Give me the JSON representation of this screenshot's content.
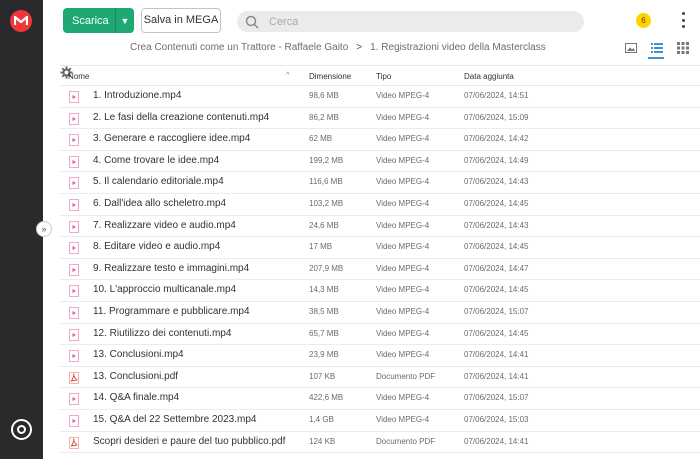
{
  "toolbar": {
    "download_label": "Scarica",
    "save_label": "Salva in MEGA",
    "search_placeholder": "Cerca",
    "notification_count": "6"
  },
  "breadcrumb": {
    "parent": "Crea Contenuti come un Trattore - Raffaele Gaito",
    "separator": ">",
    "current": "1. Registrazioni video della Masterclass"
  },
  "colors": {
    "accent_green": "#1fa873",
    "sidebar": "#2a2a2c",
    "mega_red": "#f0373a",
    "notification": "#ffd300",
    "active_view": "#3c90d4"
  },
  "table": {
    "headers": {
      "name": "Nome",
      "size": "Dimensione",
      "type": "Tipo",
      "date": "Data aggiunta"
    },
    "sort_indicator": "^",
    "rows": [
      {
        "name": "1. Introduzione.mp4",
        "size": "98,6 MB",
        "type": "Video MPEG-4",
        "date": "07/06/2024, 14:51",
        "icon": "video-file-icon"
      },
      {
        "name": "2. Le fasi della creazione contenuti.mp4",
        "size": "86,2 MB",
        "type": "Video MPEG-4",
        "date": "07/06/2024, 15:09",
        "icon": "video-file-icon"
      },
      {
        "name": "3. Generare e raccogliere idee.mp4",
        "size": "62 MB",
        "type": "Video MPEG-4",
        "date": "07/06/2024, 14:42",
        "icon": "video-file-icon"
      },
      {
        "name": "4. Come trovare le idee.mp4",
        "size": "199,2 MB",
        "type": "Video MPEG-4",
        "date": "07/06/2024, 14:49",
        "icon": "video-file-icon"
      },
      {
        "name": "5. Il calendario editoriale.mp4",
        "size": "116,6 MB",
        "type": "Video MPEG-4",
        "date": "07/06/2024, 14:43",
        "icon": "video-file-icon"
      },
      {
        "name": "6. Dall'idea allo scheletro.mp4",
        "size": "103,2 MB",
        "type": "Video MPEG-4",
        "date": "07/06/2024, 14:45",
        "icon": "video-file-icon"
      },
      {
        "name": "7. Realizzare video e audio.mp4",
        "size": "24,6 MB",
        "type": "Video MPEG-4",
        "date": "07/06/2024, 14:43",
        "icon": "video-file-icon"
      },
      {
        "name": "8. Editare video e audio.mp4",
        "size": "17 MB",
        "type": "Video MPEG-4",
        "date": "07/06/2024, 14:45",
        "icon": "video-file-icon"
      },
      {
        "name": "9. Realizzare testo e immagini.mp4",
        "size": "207,9 MB",
        "type": "Video MPEG-4",
        "date": "07/06/2024, 14:47",
        "icon": "video-file-icon"
      },
      {
        "name": "10. L'approccio multicanale.mp4",
        "size": "14,3 MB",
        "type": "Video MPEG-4",
        "date": "07/06/2024, 14:45",
        "icon": "video-file-icon"
      },
      {
        "name": "11. Programmare e pubblicare.mp4",
        "size": "38,5 MB",
        "type": "Video MPEG-4",
        "date": "07/06/2024, 15:07",
        "icon": "video-file-icon"
      },
      {
        "name": "12. Riutilizzo dei contenuti.mp4",
        "size": "65,7 MB",
        "type": "Video MPEG-4",
        "date": "07/06/2024, 14:45",
        "icon": "video-file-icon"
      },
      {
        "name": "13. Conclusioni.mp4",
        "size": "23,9 MB",
        "type": "Video MPEG-4",
        "date": "07/06/2024, 14:41",
        "icon": "video-file-icon"
      },
      {
        "name": "13. Conclusioni.pdf",
        "size": "107 KB",
        "type": "Documento PDF",
        "date": "07/06/2024, 14:41",
        "icon": "pdf-file-icon"
      },
      {
        "name": "14. Q&A finale.mp4",
        "size": "422,6 MB",
        "type": "Video MPEG-4",
        "date": "07/06/2024, 15:07",
        "icon": "video-file-icon"
      },
      {
        "name": "15. Q&A del 22 Settembre 2023.mp4",
        "size": "1,4 GB",
        "type": "Video MPEG-4",
        "date": "07/06/2024, 15:03",
        "icon": "video-file-icon"
      },
      {
        "name": "Scopri desideri e paure del tuo pubblico.pdf",
        "size": "124 KB",
        "type": "Documento PDF",
        "date": "07/06/2024, 14:41",
        "icon": "pdf-file-icon"
      }
    ]
  }
}
